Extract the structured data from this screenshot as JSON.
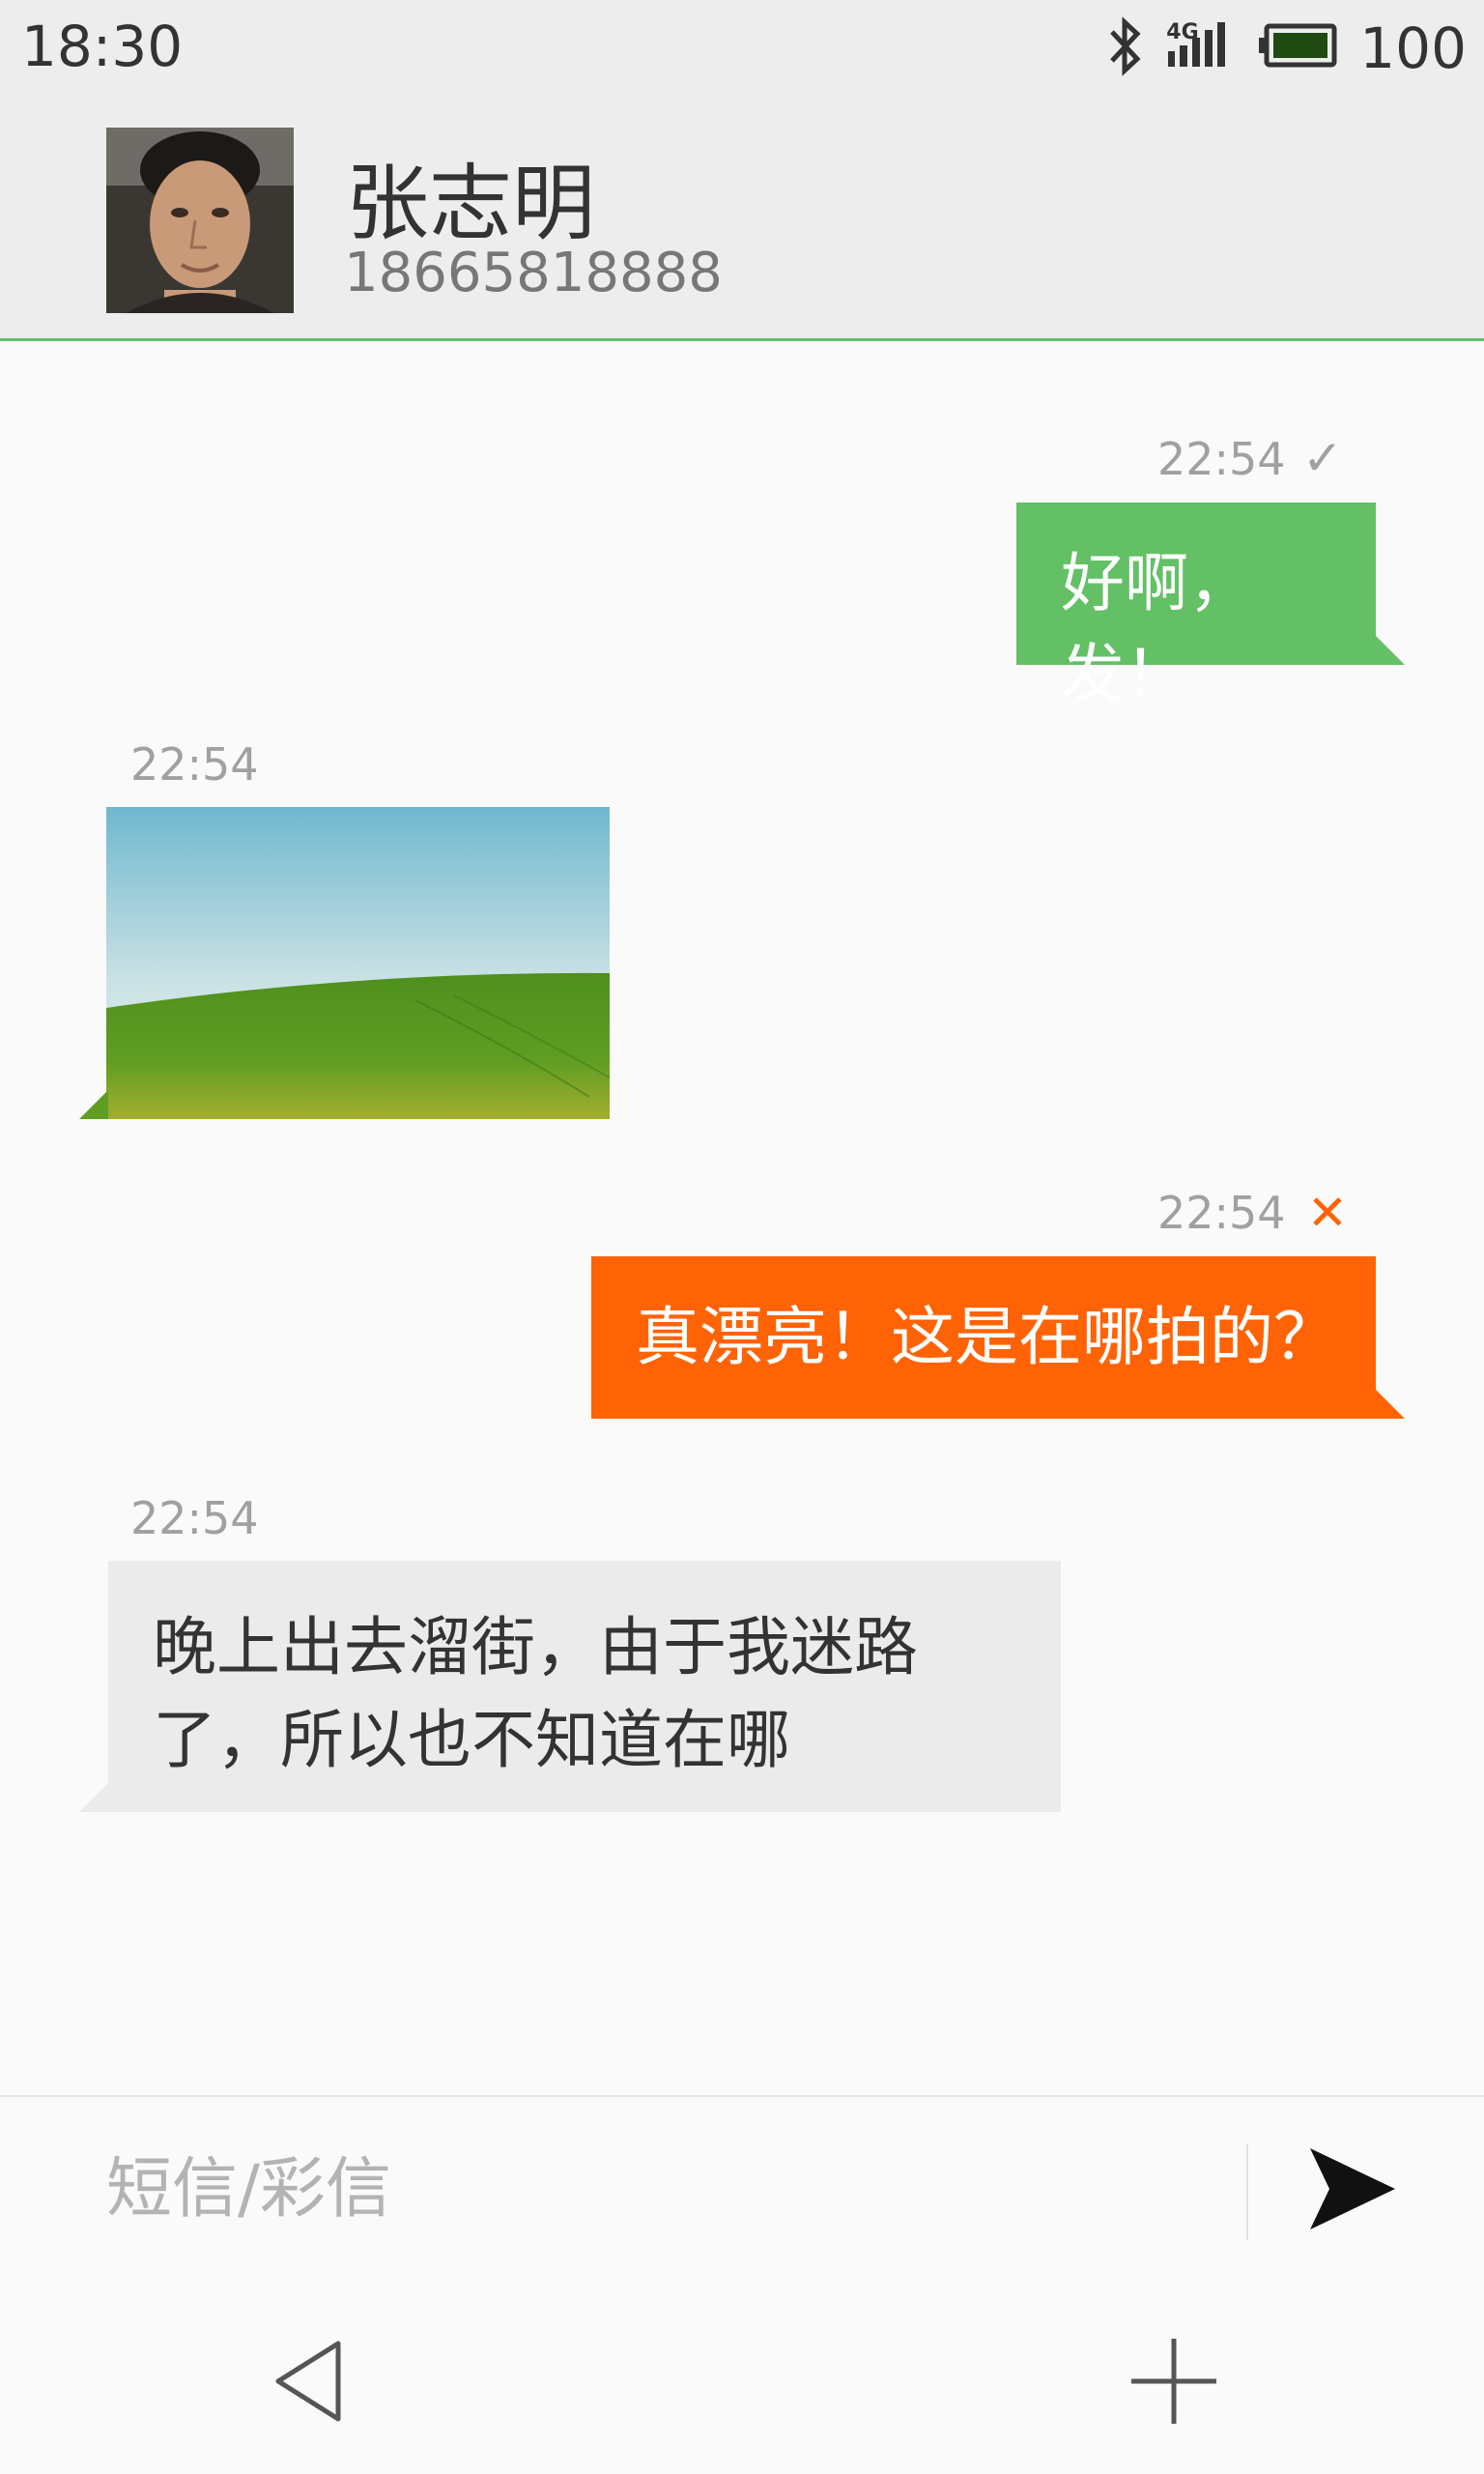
{
  "status_bar": {
    "time": "18:30",
    "battery_level": "100",
    "network_type": "4G",
    "icons": [
      "bluetooth-icon",
      "signal-icon",
      "battery-icon"
    ]
  },
  "header": {
    "contact_name": "张志明",
    "phone_number": "18665818888"
  },
  "messages": [
    {
      "direction": "outgoing",
      "time": "22:54",
      "text": "好啊，发！",
      "status": "sent",
      "status_mark": "✓"
    },
    {
      "direction": "incoming",
      "time": "22:54",
      "type": "image"
    },
    {
      "direction": "outgoing",
      "time": "22:54",
      "text": "真漂亮！这是在哪拍的？",
      "status": "failed",
      "status_mark": "✕"
    },
    {
      "direction": "incoming",
      "time": "22:54",
      "text": "晚上出去溜街，由于我迷路了，所以也不知道在哪"
    }
  ],
  "input": {
    "placeholder": "短信/彩信",
    "value": ""
  },
  "colors": {
    "outgoing_sent": "#63c065",
    "outgoing_failed": "#ff6306",
    "incoming": "#ebebeb",
    "accent": "#5fbf6a",
    "failed_mark": "#ff6306"
  },
  "nav": {
    "icons": [
      "back-triangle-icon",
      "plus-icon"
    ]
  }
}
